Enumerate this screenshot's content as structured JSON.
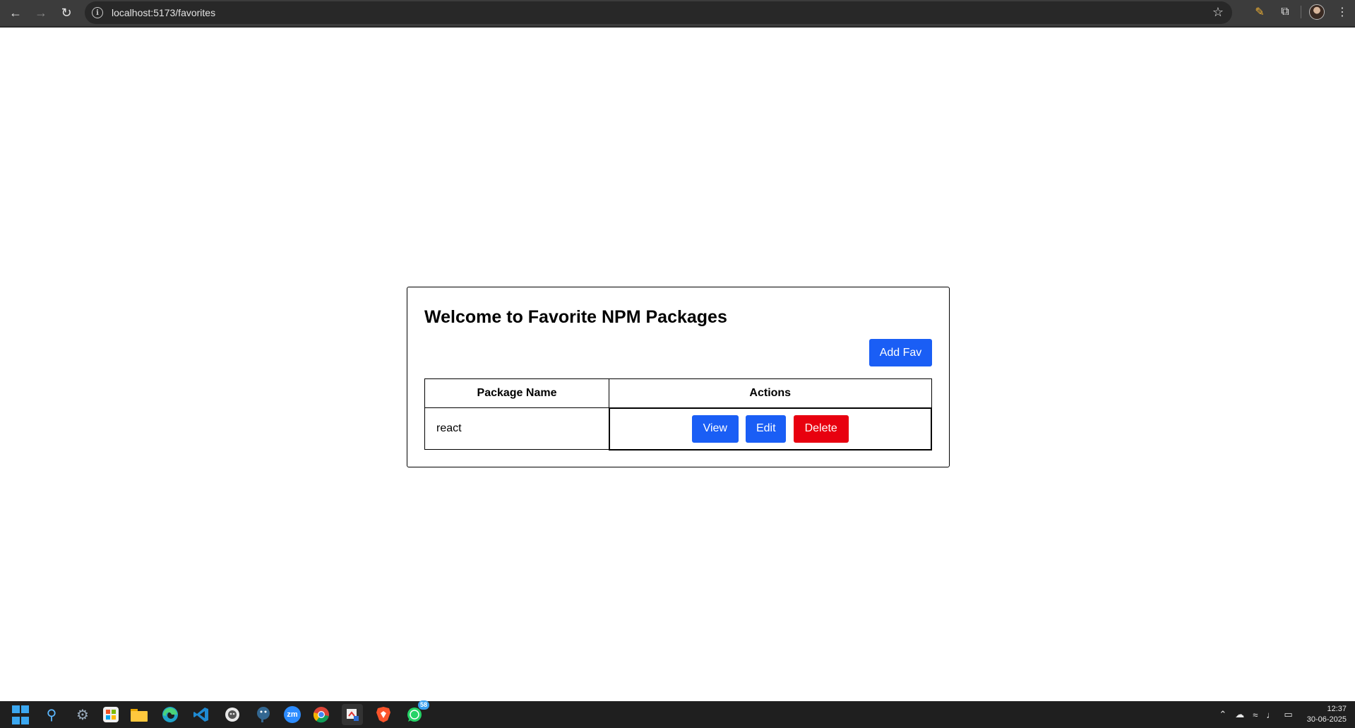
{
  "browser": {
    "url": "localhost:5173/favorites",
    "icons": {
      "back": "back-arrow-icon",
      "forward": "forward-arrow-icon",
      "reload": "reload-icon",
      "info": "site-info-icon",
      "bookmark": "star-icon",
      "pen": "pen-icon",
      "extensions": "puzzle-icon",
      "profile": "avatar",
      "menu": "kebab-menu-icon"
    }
  },
  "page": {
    "title": "Welcome to Favorite NPM Packages",
    "add_button": "Add Fav",
    "table": {
      "headers": [
        "Package Name",
        "Actions"
      ],
      "rows": [
        {
          "name": "react",
          "actions": [
            "View",
            "Edit",
            "Delete"
          ]
        }
      ]
    },
    "colors": {
      "primary": "#1a5ef5",
      "danger": "#e8000f"
    }
  },
  "taskbar": {
    "apps": [
      "windows-start",
      "search",
      "settings",
      "store",
      "file-explorer",
      "edge",
      "vscode",
      "github-desktop",
      "postgres",
      "zoom",
      "chrome",
      "snipping-tool",
      "brave",
      "whatsapp"
    ],
    "whatsapp_badge": "58",
    "zoom_label": "zm",
    "time": "12:37",
    "date": "30-06-2025"
  }
}
